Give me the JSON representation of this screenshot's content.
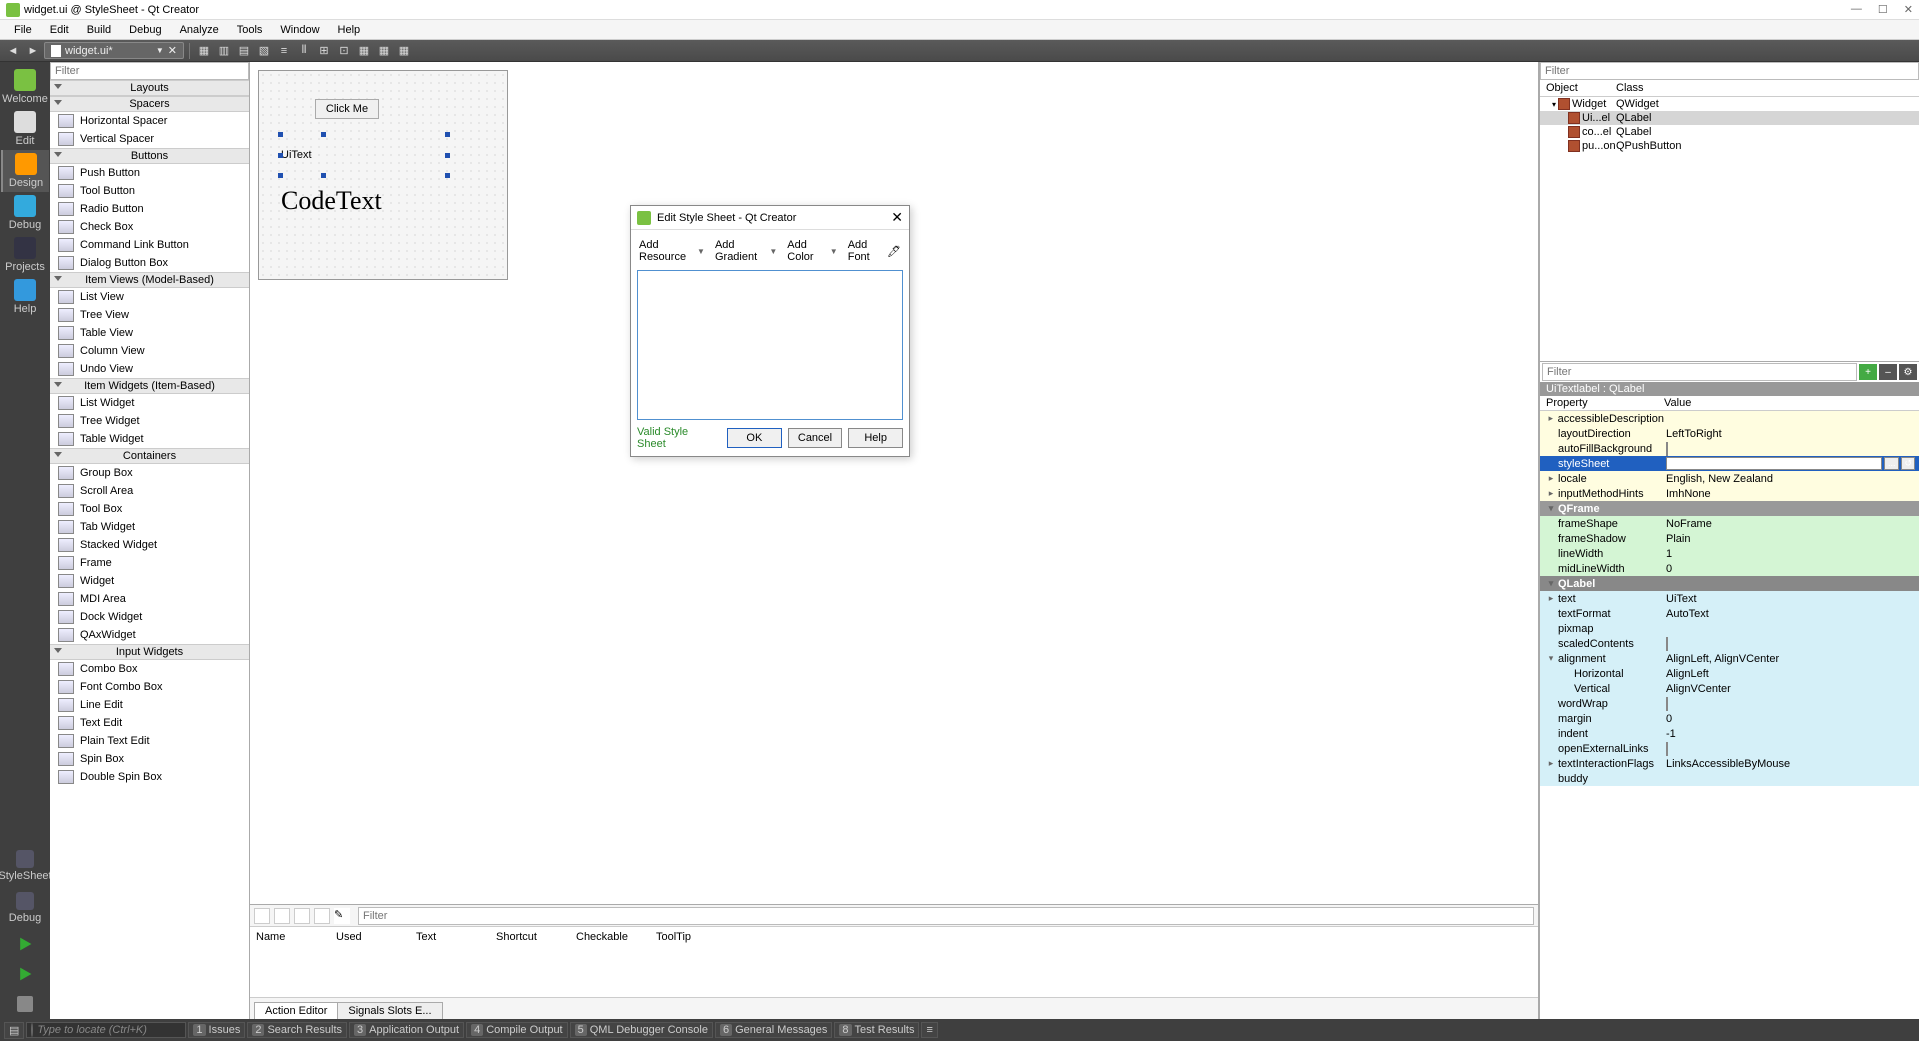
{
  "window": {
    "title": "widget.ui @ StyleSheet - Qt Creator"
  },
  "menubar": [
    "File",
    "Edit",
    "Build",
    "Debug",
    "Analyze",
    "Tools",
    "Window",
    "Help"
  ],
  "document_tab": "widget.ui*",
  "leftrail": [
    {
      "label": "Welcome"
    },
    {
      "label": "Edit"
    },
    {
      "label": "Design"
    },
    {
      "label": "Debug"
    },
    {
      "label": "Projects"
    },
    {
      "label": "Help"
    }
  ],
  "leftrail_bottom": [
    {
      "label": "StyleSheet"
    },
    {
      "label": "Debug"
    }
  ],
  "widgetbox": {
    "filter_placeholder": "Filter",
    "groups": [
      {
        "title": "Layouts",
        "items": []
      },
      {
        "title": "Spacers",
        "items": [
          "Horizontal Spacer",
          "Vertical Spacer"
        ]
      },
      {
        "title": "Buttons",
        "items": [
          "Push Button",
          "Tool Button",
          "Radio Button",
          "Check Box",
          "Command Link Button",
          "Dialog Button Box"
        ]
      },
      {
        "title": "Item Views (Model-Based)",
        "items": [
          "List View",
          "Tree View",
          "Table View",
          "Column View",
          "Undo View"
        ]
      },
      {
        "title": "Item Widgets (Item-Based)",
        "items": [
          "List Widget",
          "Tree Widget",
          "Table Widget"
        ]
      },
      {
        "title": "Containers",
        "items": [
          "Group Box",
          "Scroll Area",
          "Tool Box",
          "Tab Widget",
          "Stacked Widget",
          "Frame",
          "Widget",
          "MDI Area",
          "Dock Widget",
          "QAxWidget"
        ]
      },
      {
        "title": "Input Widgets",
        "items": [
          "Combo Box",
          "Font Combo Box",
          "Line Edit",
          "Text Edit",
          "Plain Text Edit",
          "Spin Box",
          "Double Spin Box"
        ]
      }
    ]
  },
  "form": {
    "button": "Click Me",
    "text1": "UiText",
    "text2": "CodeText"
  },
  "action_editor": {
    "filter_placeholder": "Filter",
    "columns": [
      "Name",
      "Used",
      "Text",
      "Shortcut",
      "Checkable",
      "ToolTip"
    ],
    "tabs": [
      "Action Editor",
      "Signals  Slots E..."
    ]
  },
  "object_inspector": {
    "filter_placeholder": "Filter",
    "columns": [
      "Object",
      "Class"
    ],
    "rows": [
      {
        "obj": "Widget",
        "cls": "QWidget",
        "indent": 0,
        "expand": true
      },
      {
        "obj": "Ui...el",
        "cls": "QLabel",
        "indent": 1,
        "selected": true
      },
      {
        "obj": "co...el",
        "cls": "QLabel",
        "indent": 1
      },
      {
        "obj": "pu...on",
        "cls": "QPushButton",
        "indent": 1
      }
    ]
  },
  "property_editor": {
    "filter_placeholder": "Filter",
    "crumb": "UiTextlabel : QLabel",
    "columns": [
      "Property",
      "Value"
    ],
    "rows": [
      {
        "name": "accessibleDescription",
        "value": "",
        "cls": "yellow",
        "arrow": ">"
      },
      {
        "name": "layoutDirection",
        "value": "LeftToRight",
        "cls": "yellow"
      },
      {
        "name": "autoFillBackground",
        "value": "",
        "cls": "yellow",
        "checkbox": true
      },
      {
        "name": "styleSheet",
        "value": "",
        "cls": "selected-blue",
        "edit": true
      },
      {
        "name": "locale",
        "value": "English, New Zealand",
        "cls": "yellow",
        "arrow": ">"
      },
      {
        "name": "inputMethodHints",
        "value": "ImhNone",
        "cls": "yellow",
        "arrow": ">"
      },
      {
        "name": "QFrame",
        "value": "",
        "cls": "green-hdr",
        "arrow": "v"
      },
      {
        "name": "frameShape",
        "value": "NoFrame",
        "cls": "green"
      },
      {
        "name": "frameShadow",
        "value": "Plain",
        "cls": "green"
      },
      {
        "name": "lineWidth",
        "value": "1",
        "cls": "green"
      },
      {
        "name": "midLineWidth",
        "value": "0",
        "cls": "green"
      },
      {
        "name": "QLabel",
        "value": "",
        "cls": "blue-hdr",
        "arrow": "v"
      },
      {
        "name": "text",
        "value": "UiText",
        "cls": "blue",
        "arrow": ">"
      },
      {
        "name": "textFormat",
        "value": "AutoText",
        "cls": "blue"
      },
      {
        "name": "pixmap",
        "value": "",
        "cls": "blue"
      },
      {
        "name": "scaledContents",
        "value": "",
        "cls": "blue",
        "checkbox": true
      },
      {
        "name": "alignment",
        "value": "AlignLeft, AlignVCenter",
        "cls": "blue",
        "arrow": "v"
      },
      {
        "name": "Horizontal",
        "value": "AlignLeft",
        "cls": "blue",
        "indent": true
      },
      {
        "name": "Vertical",
        "value": "AlignVCenter",
        "cls": "blue",
        "indent": true
      },
      {
        "name": "wordWrap",
        "value": "",
        "cls": "blue",
        "checkbox": true
      },
      {
        "name": "margin",
        "value": "0",
        "cls": "blue"
      },
      {
        "name": "indent",
        "value": "-1",
        "cls": "blue"
      },
      {
        "name": "openExternalLinks",
        "value": "",
        "cls": "blue",
        "checkbox": true
      },
      {
        "name": "textInteractionFlags",
        "value": "LinksAccessibleByMouse",
        "cls": "blue",
        "arrow": ">"
      },
      {
        "name": "buddy",
        "value": "",
        "cls": "blue"
      }
    ]
  },
  "dialog": {
    "title": "Edit Style Sheet - Qt Creator",
    "toolbar": [
      "Add Resource",
      "Add Gradient",
      "Add Color",
      "Add Font"
    ],
    "valid": "Valid Style Sheet",
    "buttons": {
      "ok": "OK",
      "cancel": "Cancel",
      "help": "Help"
    }
  },
  "statusbar": {
    "locator_placeholder": "Type to locate (Ctrl+K)",
    "panes": [
      {
        "num": "1",
        "label": "Issues"
      },
      {
        "num": "2",
        "label": "Search Results"
      },
      {
        "num": "3",
        "label": "Application Output"
      },
      {
        "num": "4",
        "label": "Compile Output"
      },
      {
        "num": "5",
        "label": "QML Debugger Console"
      },
      {
        "num": "6",
        "label": "General Messages"
      },
      {
        "num": "8",
        "label": "Test Results"
      }
    ]
  }
}
